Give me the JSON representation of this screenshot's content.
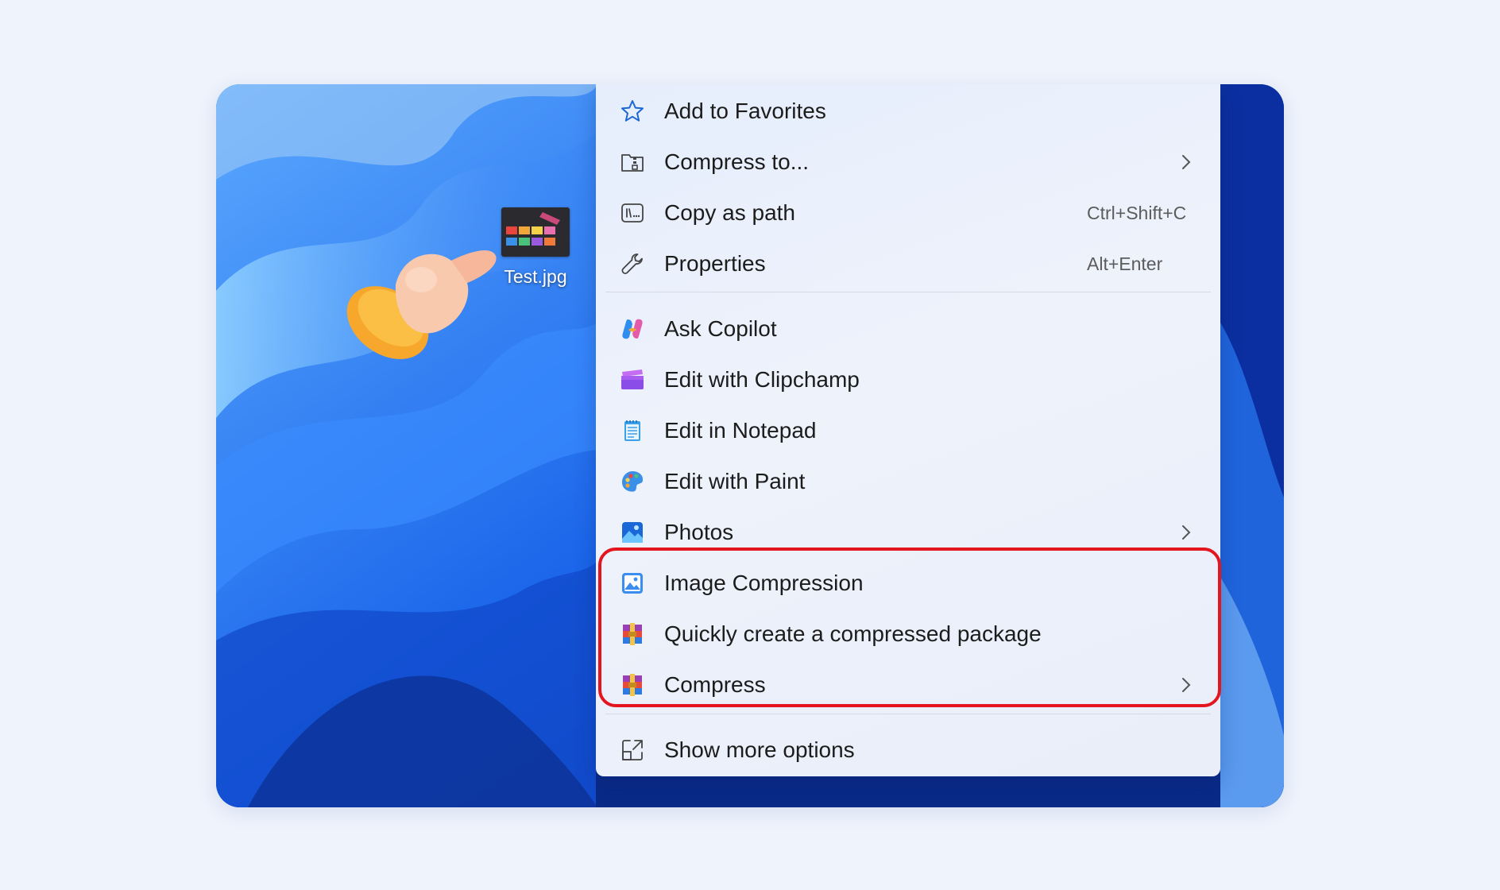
{
  "desktop": {
    "file_name": "Test.jpg"
  },
  "menu": {
    "items": [
      {
        "label": "Add to Favorites",
        "icon": "star-icon"
      },
      {
        "label": "Compress to...",
        "icon": "zip-folder-icon",
        "submenu": true
      },
      {
        "label": "Copy as path",
        "icon": "copy-path-icon",
        "shortcut": "Ctrl+Shift+C"
      },
      {
        "label": "Properties",
        "icon": "wrench-icon",
        "shortcut": "Alt+Enter"
      },
      {
        "label": "Ask Copilot",
        "icon": "copilot-icon"
      },
      {
        "label": "Edit with Clipchamp",
        "icon": "clipchamp-icon"
      },
      {
        "label": "Edit in Notepad",
        "icon": "notepad-icon"
      },
      {
        "label": "Edit with Paint",
        "icon": "paint-icon"
      },
      {
        "label": "Photos",
        "icon": "photos-icon",
        "submenu": true
      },
      {
        "label": "Image Compression",
        "icon": "image-compression-icon"
      },
      {
        "label": "Quickly create a compressed package",
        "icon": "winrar-icon"
      },
      {
        "label": "Compress",
        "icon": "winrar-icon",
        "submenu": true
      },
      {
        "label": "Show more options",
        "icon": "expand-icon"
      }
    ]
  },
  "colors": {
    "highlight": "#e31620",
    "accent_blue": "#1a67d8"
  }
}
